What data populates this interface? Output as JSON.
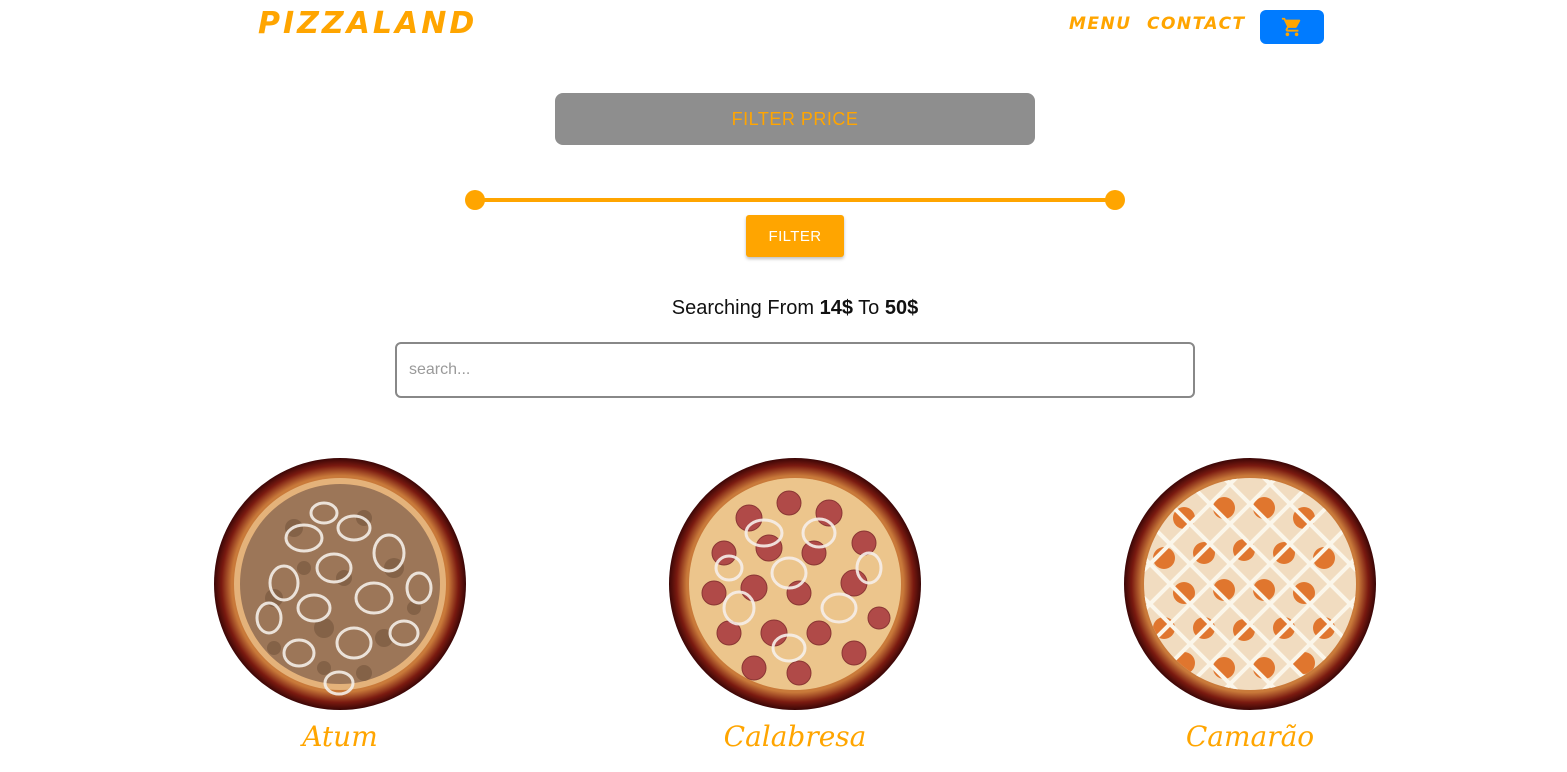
{
  "navbar": {
    "logo": "PIZZALAND",
    "links": [
      {
        "label": "MENU"
      },
      {
        "label": "CONTACT"
      }
    ],
    "cart_icon": "shopping-cart-icon",
    "cart_color": "#007bff"
  },
  "filter": {
    "header_label": "FILTER PRICE",
    "button_label": "FILTER",
    "slider": {
      "min_fraction": 0.0,
      "max_fraction": 1.0
    },
    "searching": {
      "prefix": "Searching From",
      "from": "14$",
      "middle": "To",
      "to": "50$"
    }
  },
  "search": {
    "placeholder": "search..."
  },
  "pizzas": [
    {
      "name": "Atum",
      "topping": "tuna-onion"
    },
    {
      "name": "Calabresa",
      "topping": "pepperoni-onion"
    },
    {
      "name": "Camarão",
      "topping": "shrimp-cream"
    }
  ],
  "colors": {
    "accent": "#ffa500",
    "header_bg": "#8e8e8e",
    "cart_bg": "#007bff"
  }
}
